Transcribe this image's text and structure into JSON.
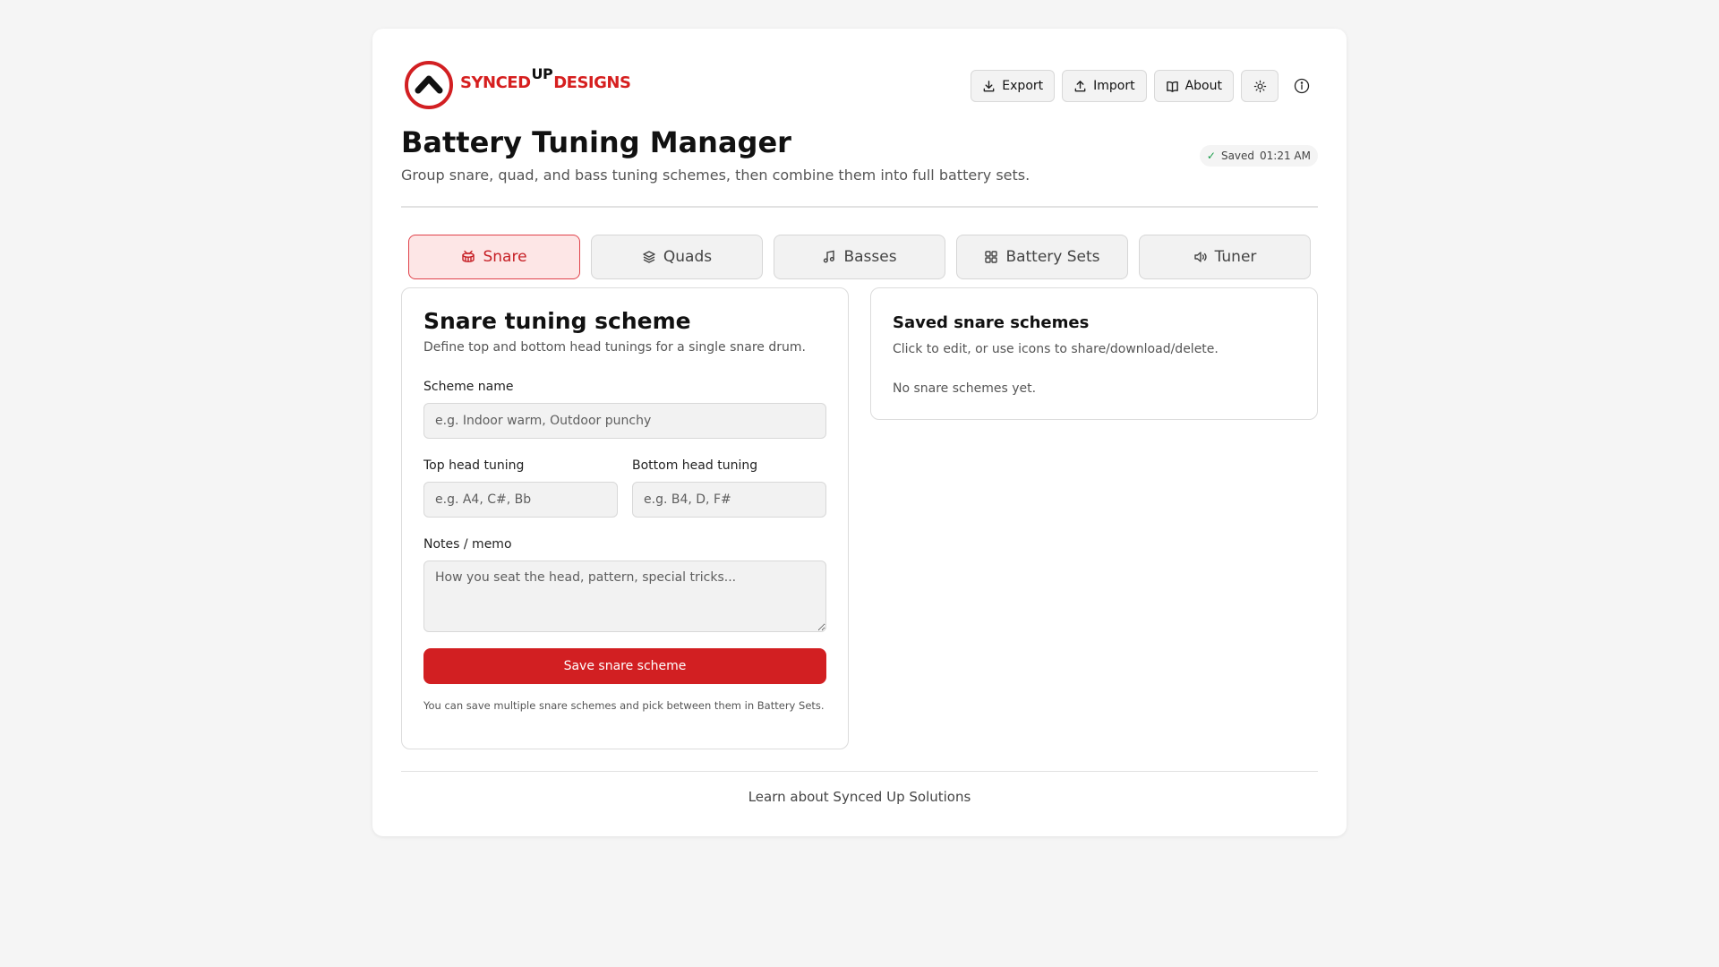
{
  "brand": {
    "name_left": "SYNCED",
    "name_up": "UP",
    "name_right": "DESIGNS",
    "accent": "#d21f22"
  },
  "toolbar": {
    "export_label": "Export",
    "import_label": "Import",
    "about_label": "About",
    "theme_icon": "sun-icon",
    "info_icon": "info-icon"
  },
  "header": {
    "title": "Battery Tuning Manager",
    "subtitle": "Group snare, quad, and bass tuning schemes, then combine them into full battery sets.",
    "saved_label": "Saved",
    "saved_time": "01:21 AM"
  },
  "tabs": [
    {
      "label": "Snare",
      "icon": "drum-icon",
      "active": true
    },
    {
      "label": "Quads",
      "icon": "layers-icon",
      "active": false
    },
    {
      "label": "Basses",
      "icon": "music-note-icon",
      "active": false
    },
    {
      "label": "Battery Sets",
      "icon": "grid-icon",
      "active": false
    },
    {
      "label": "Tuner",
      "icon": "speaker-icon",
      "active": false
    }
  ],
  "snare_form": {
    "title": "Snare tuning scheme",
    "description": "Define top and bottom head tunings for a single snare drum.",
    "scheme_name_label": "Scheme name",
    "scheme_name_placeholder": "e.g. Indoor warm, Outdoor punchy",
    "top_head_label": "Top head tuning",
    "top_head_placeholder": "e.g. A4, C#, Bb",
    "bottom_head_label": "Bottom head tuning",
    "bottom_head_placeholder": "e.g. B4, D, F#",
    "notes_label": "Notes / memo",
    "notes_placeholder": "How you seat the head, pattern, special tricks...",
    "save_label": "Save snare scheme",
    "hint": "You can save multiple snare schemes and pick between them in Battery Sets."
  },
  "saved_schemes": {
    "title": "Saved snare schemes",
    "description": "Click to edit, or use icons to share/download/delete.",
    "empty": "No snare schemes yet."
  },
  "footer": {
    "link": "Learn about Synced Up Solutions"
  }
}
